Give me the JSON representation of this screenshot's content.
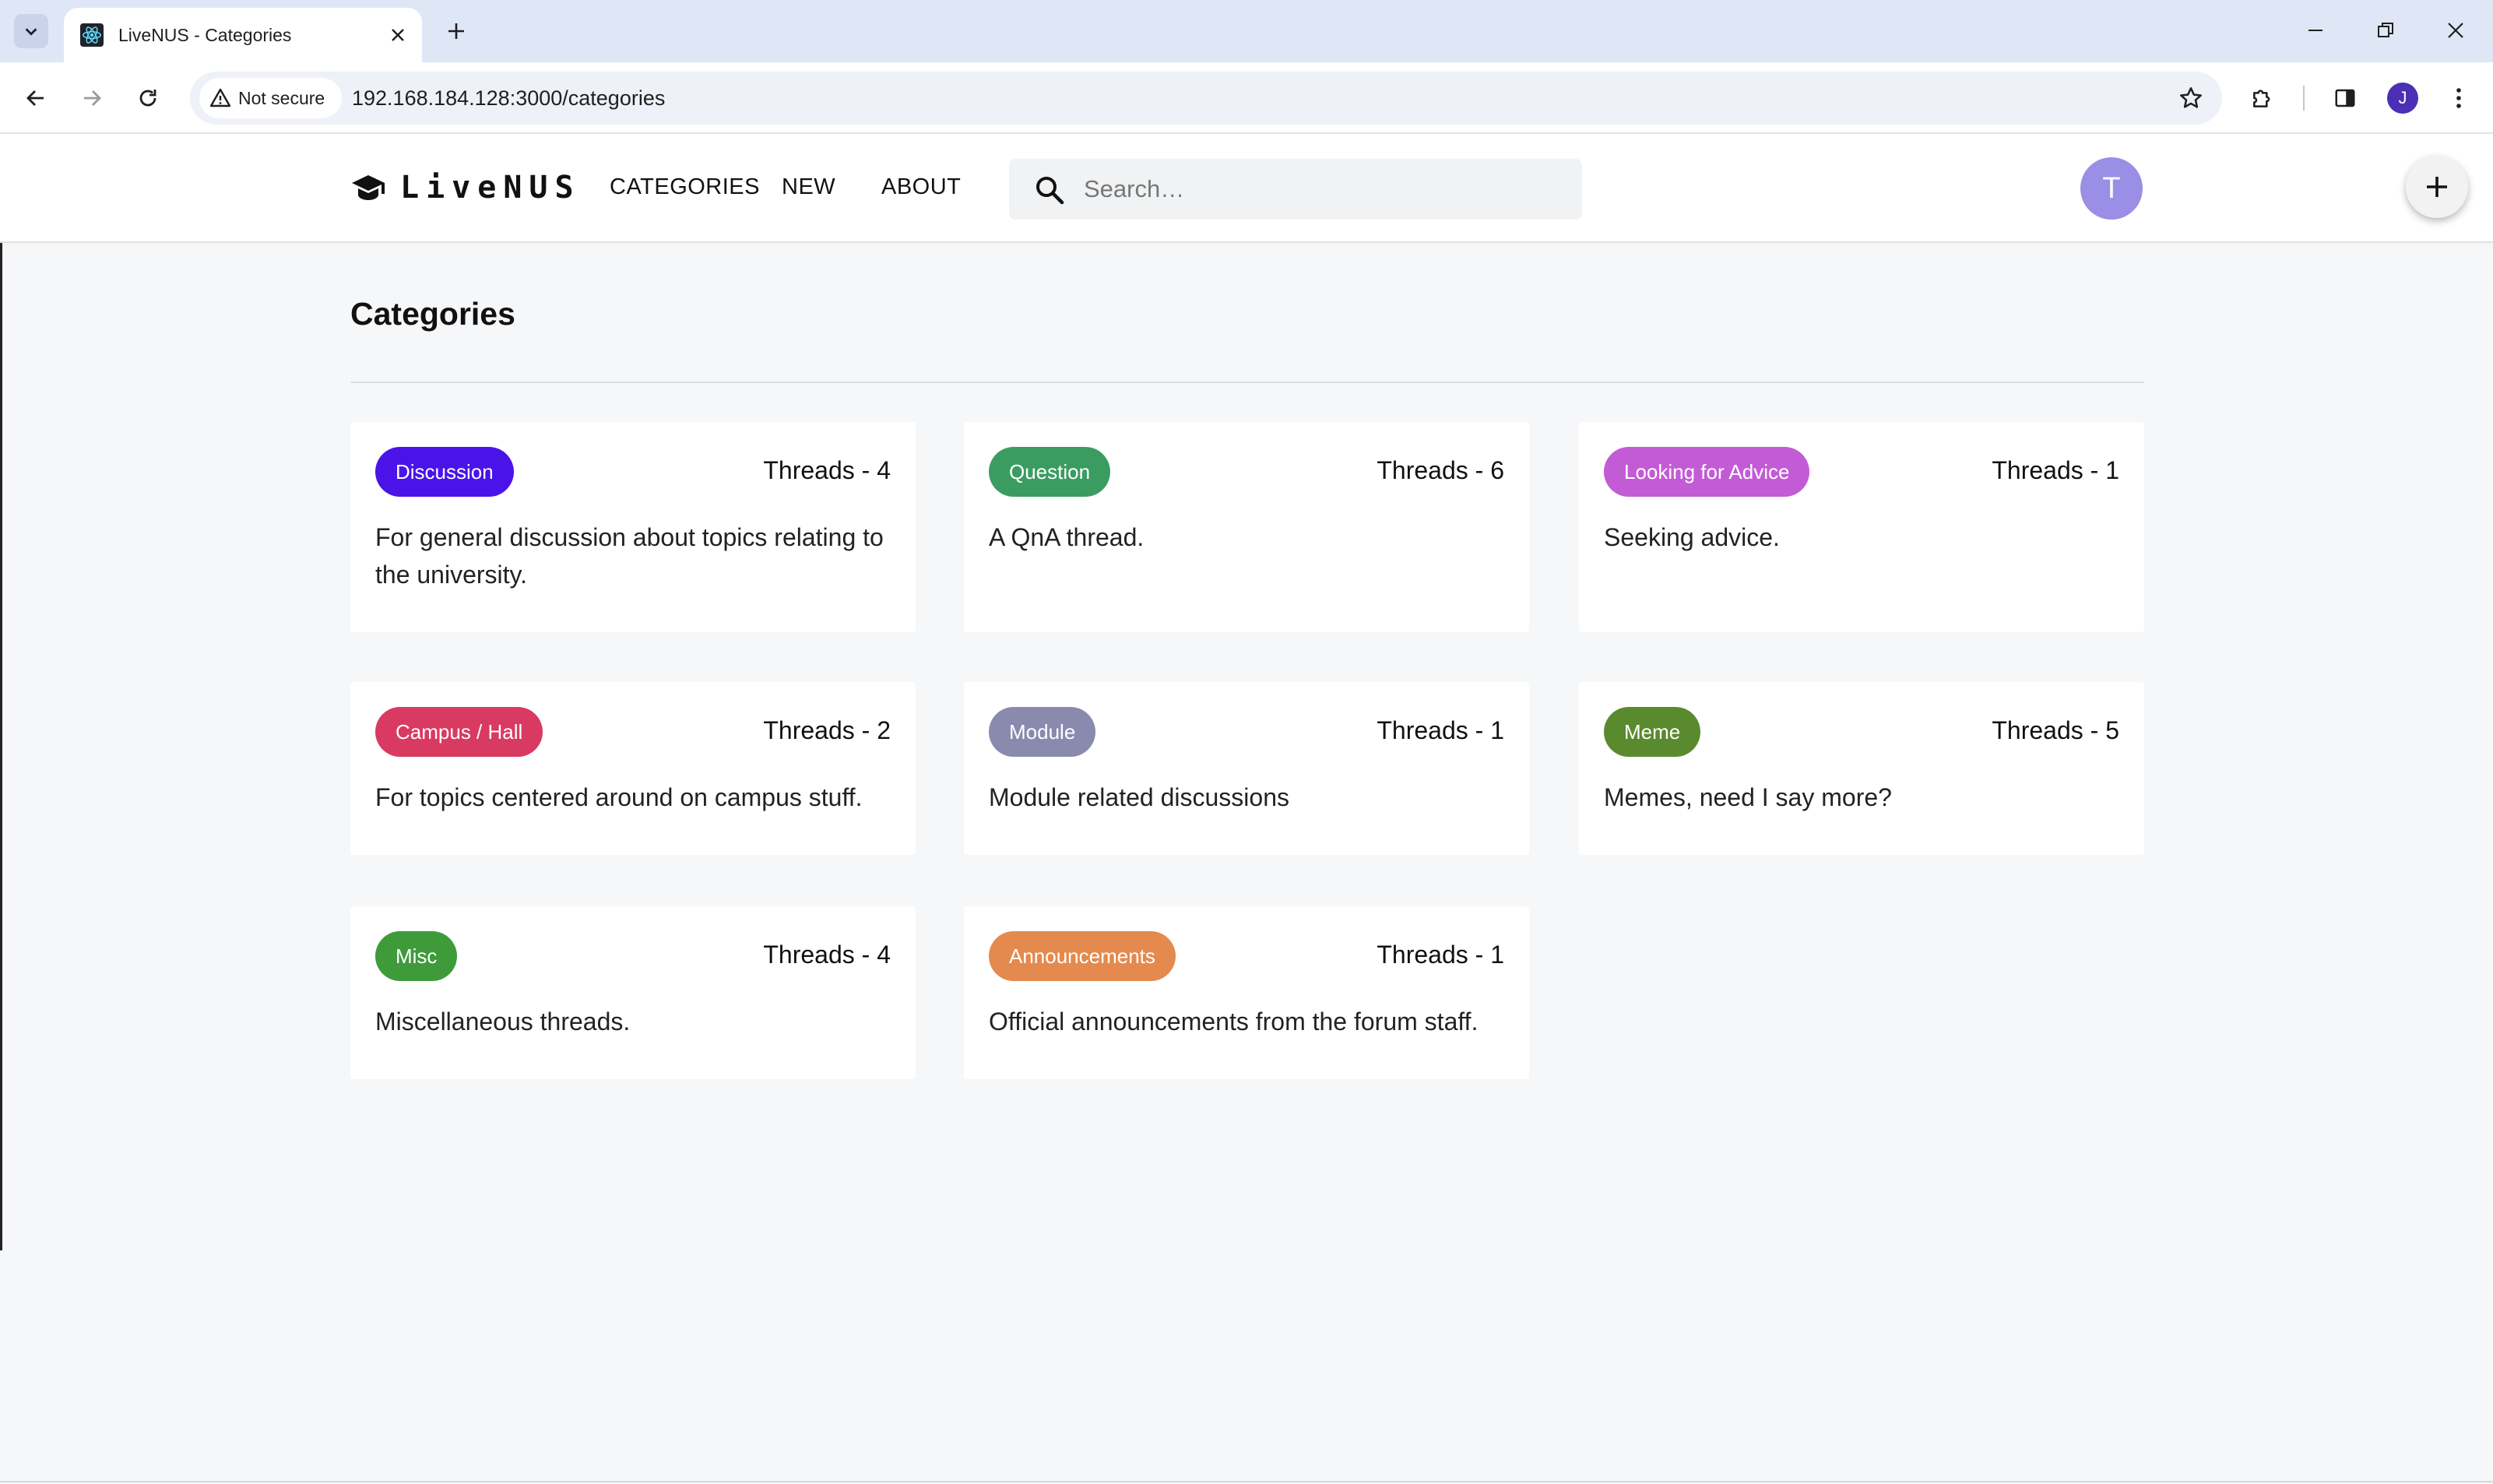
{
  "browser": {
    "tab_title": "LiveNUS - Categories",
    "security_label": "Not secure",
    "url": "192.168.184.128:3000/categories",
    "profile_initial": "J"
  },
  "app": {
    "brand": "LiveNUS",
    "nav": [
      "CATEGORIES",
      "NEW",
      "ABOUT"
    ],
    "search_placeholder": "Search…",
    "avatar_initial": "T"
  },
  "page": {
    "title": "Categories"
  },
  "categories": [
    {
      "name": "Discussion",
      "threads": "Threads - 4",
      "description": "For general discussion about topics relating to the university.",
      "color": "#4a14e8"
    },
    {
      "name": "Question",
      "threads": "Threads - 6",
      "description": "A QnA thread.",
      "color": "#3b9c62"
    },
    {
      "name": "Looking for Advice",
      "threads": "Threads - 1",
      "description": "Seeking advice.",
      "color": "#c35bd6"
    },
    {
      "name": "Campus / Hall",
      "threads": "Threads - 2",
      "description": "For topics centered around on campus stuff.",
      "color": "#d93a62"
    },
    {
      "name": "Module",
      "threads": "Threads - 1",
      "description": "Module related discussions",
      "color": "#8a8aae"
    },
    {
      "name": "Meme",
      "threads": "Threads - 5",
      "description": "Memes, need I say more?",
      "color": "#5a8a2e"
    },
    {
      "name": "Misc",
      "threads": "Threads - 4",
      "description": "Miscellaneous threads.",
      "color": "#3f9a3a"
    },
    {
      "name": "Announcements",
      "threads": "Threads - 1",
      "description": "Official announcements from the forum staff.",
      "color": "#e48a4e"
    }
  ]
}
